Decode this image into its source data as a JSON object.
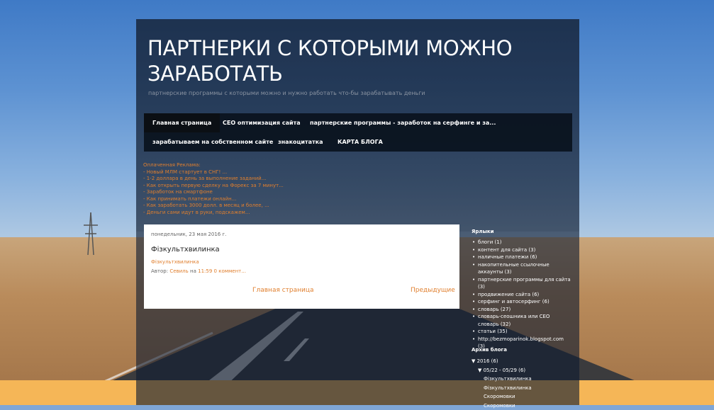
{
  "blog": {
    "title": "ПАРТНЕРКИ С КОТОРЫМИ МОЖНО ЗАРАБОТАТЬ",
    "description": "партнерские программы с которыми можно и нужно работать что-бы зарабатывать деньги"
  },
  "nav": {
    "tabs": [
      {
        "label": "Главная страница"
      },
      {
        "label": "СЕО оптимизация сайта"
      },
      {
        "label": "партнерские программы - заработок на серфинге и за..."
      },
      {
        "label": "зарабатываем на собственном сайте"
      },
      {
        "label": "знакоцитатка"
      },
      {
        "label": "КАРТА БЛОГА"
      }
    ]
  },
  "ads": {
    "title": "Оплаченная Реклама:",
    "items": [
      "- Новый МЛМ стартует в СНГ! ...",
      "- 1-2 доллара в день за выполнение заданий...",
      "- Как открыть первую сделку на Форекс за 7 минут...",
      "- Заработок на смартфоне",
      "- Как принимать платежи онлайн...",
      "- Как заработать 3000 долл. в месяц и более, ...",
      "- Деньги сами идут в руки, подскажем..."
    ]
  },
  "post": {
    "date": "понедельник, 23 мая 2016 г.",
    "title": "Фізкультхвилинка",
    "link_text": "Фізкультхвилинка",
    "author_prefix": "Автор:",
    "author": "Севиль",
    "time_prefix": "на",
    "time": "11:59",
    "comments": "0 коммент...",
    "pager_home": "Главная страница",
    "pager_prev": "Предыдущие"
  },
  "sidebar": {
    "labels_title": "Ярлыки",
    "labels": [
      "блоги (1)",
      "контент для сайта (3)",
      "наличные платежи (6)",
      "накопительные ссылочные аккаунты (3)",
      "партнерские программы для сайта (3)",
      "продвижение сайта (6)",
      "серфинг и автосерфинг (6)",
      "словарь (27)",
      "словарь-сеошника или СЕО словарь (32)",
      "статьи (35)",
      "http://bezmoparinok.blogspot.com (3)"
    ],
    "archive_title": "Архив блога",
    "archive_year": "▼ 2016 (6)",
    "archive_month": "▼ 05/22 - 05/29 (6)",
    "archive_posts": [
      "Фізкультхвилинка",
      "Фізкультхвилинка",
      "Скоромовки",
      "Скоромовки"
    ]
  },
  "colors": {
    "accent": "#e07f2e",
    "nav_bg": "#0b121b",
    "bottom_band": "#f5b657"
  }
}
